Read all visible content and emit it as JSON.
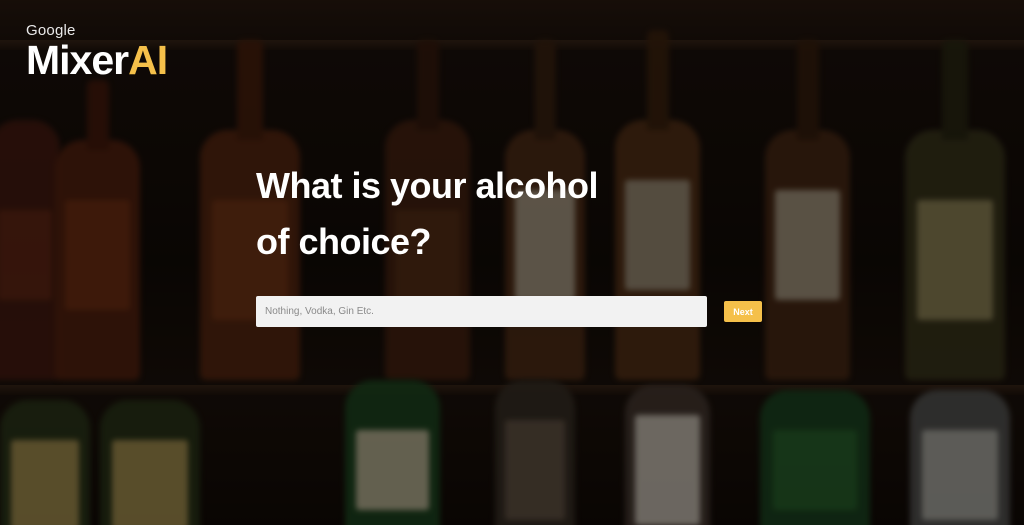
{
  "brand": {
    "company": "Google",
    "app_name_primary": "Mixer",
    "app_name_accent": "AI",
    "accent_color": "#f5c04a"
  },
  "question": {
    "line1": "What is your alcohol",
    "line2": "of choice?"
  },
  "input": {
    "placeholder": "Nothing, Vodka, Gin Etc.",
    "value": ""
  },
  "actions": {
    "next_label": "Next"
  },
  "background": {
    "description_icon": "liquor-shelf-background"
  }
}
